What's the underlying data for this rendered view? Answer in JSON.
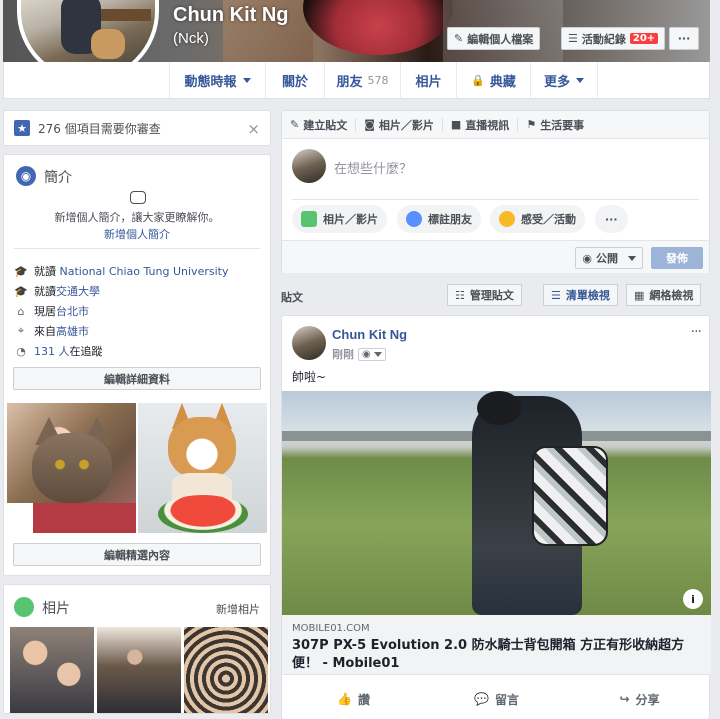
{
  "profile": {
    "name": "Chun Kit Ng",
    "nickname": "(Nck)",
    "edit_profile": "編輯個人檔案",
    "activity_log": "活動紀錄",
    "activity_badge": "20+",
    "more_dots": "···"
  },
  "nav": {
    "items": [
      {
        "label": "動態時報",
        "dropdown": true
      },
      {
        "label": "關於"
      },
      {
        "label": "朋友",
        "count": "578"
      },
      {
        "label": "相片"
      },
      {
        "label": "典藏",
        "icon": "lock-icon"
      },
      {
        "label": "更多",
        "dropdown": true
      }
    ]
  },
  "review": {
    "text": "276 個項目需要你審查",
    "close": "×"
  },
  "intro": {
    "title": "簡介",
    "prompt": "新增個人簡介，讓大家更瞭解你。",
    "add_bio": "新增個人簡介",
    "rows": [
      {
        "prefix": "就讀",
        "link": "National Chiao Tung University",
        "suffix": ""
      },
      {
        "prefix": "就讀",
        "link": "交通大學",
        "suffix": ""
      },
      {
        "prefix": "現居",
        "link": "台北市",
        "suffix": ""
      },
      {
        "prefix": "來自",
        "link": "高雄市",
        "suffix": ""
      },
      {
        "prefix": "",
        "link": "131 人",
        "suffix": "在追蹤"
      }
    ],
    "edit_details": "編輯詳細資料",
    "edit_featured": "編輯精選內容"
  },
  "photos": {
    "title": "相片",
    "add": "新增相片"
  },
  "composer": {
    "tabs": [
      "建立貼文",
      "相片／影片",
      "直播視訊",
      "生活要事"
    ],
    "placeholder": "在想些什麼？",
    "pills": [
      "相片／影片",
      "標註朋友",
      "感受／活動",
      "···"
    ],
    "privacy": "公開",
    "post_button": "發佈"
  },
  "posts_header": {
    "label": "貼文",
    "manage": "管理貼文",
    "list_view": "清單檢視",
    "grid_view": "網格檢視"
  },
  "post": {
    "author": "Chun Kit Ng",
    "time": "剛剛",
    "text": "帥啦~",
    "link_domain": "MOBILE01.COM",
    "link_title": "307P PX-5 Evolution 2.0 防水騎士背包開箱 方正有形收納超方便！ - Mobile01",
    "info": "i",
    "actions": [
      "讚",
      "留言",
      "分享"
    ],
    "more_dots": "···"
  },
  "colors": {
    "link": "#365899",
    "brand": "#4267b2",
    "background": "#e9ebee",
    "badge": "#fa3e3e"
  }
}
